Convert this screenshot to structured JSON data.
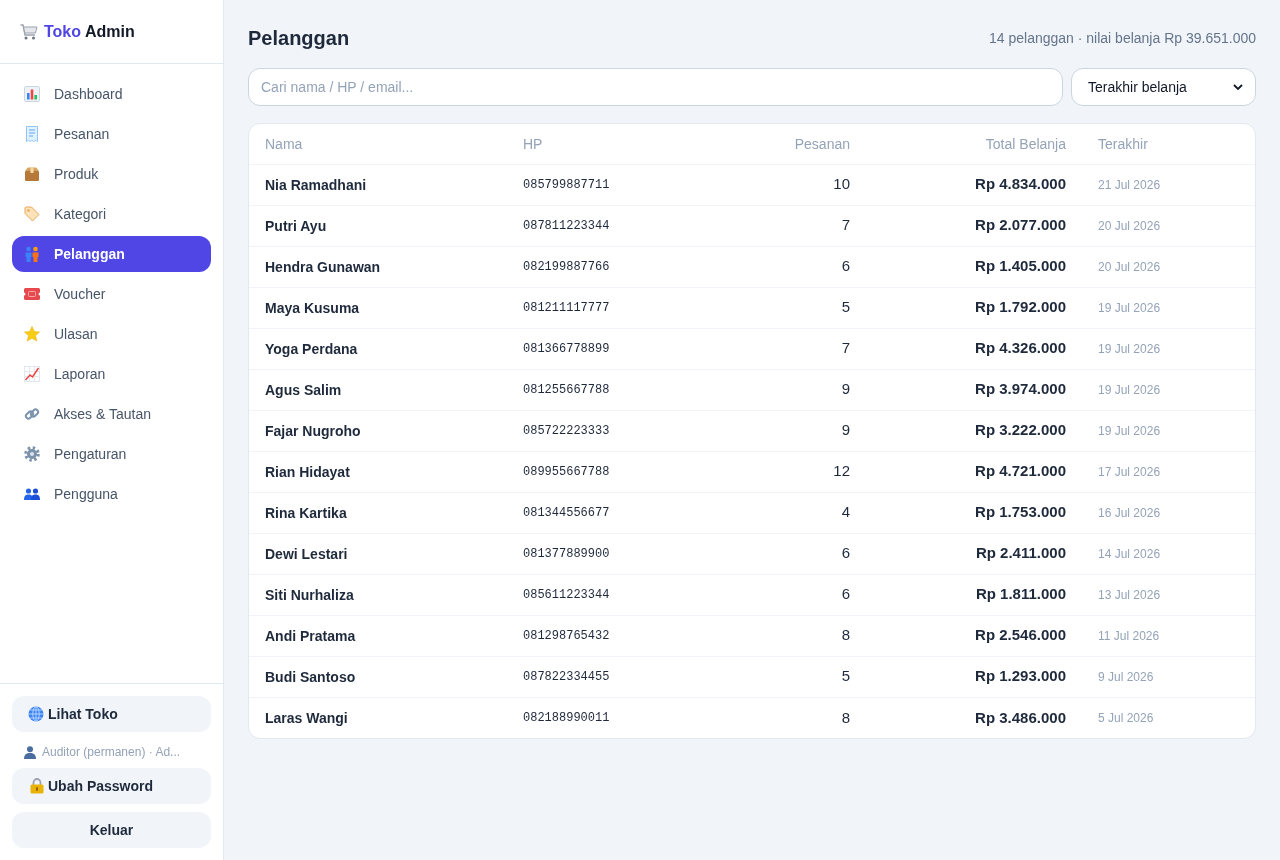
{
  "sidebar": {
    "brand": {
      "accent": "Toko",
      "name": "Admin"
    },
    "items": [
      {
        "label": "Dashboard",
        "selected": false
      },
      {
        "label": "Pesanan",
        "selected": false
      },
      {
        "label": "Produk",
        "selected": false
      },
      {
        "label": "Kategori",
        "selected": false
      },
      {
        "label": "Pelanggan",
        "selected": true
      },
      {
        "label": "Voucher",
        "selected": false
      },
      {
        "label": "Ulasan",
        "selected": false
      },
      {
        "label": "Laporan",
        "selected": false
      },
      {
        "label": "Akses & Tautan",
        "selected": false
      },
      {
        "label": "Pengaturan",
        "selected": false
      },
      {
        "label": "Pengguna",
        "selected": false
      }
    ],
    "footer": {
      "store_button": "Lihat Toko",
      "account": "Auditor (permanen) · Ad...",
      "password_button": "Ubah Password",
      "logout_button": "Keluar"
    }
  },
  "page": {
    "title": "Pelanggan",
    "summary": "14 pelanggan · nilai belanja Rp 39.651.000",
    "search": {
      "placeholder": "Cari nama / HP / email..."
    },
    "sort": {
      "value": "Terakhir belanja"
    }
  },
  "table": {
    "columns": [
      "Nama",
      "HP",
      "Pesanan",
      "Total Belanja",
      "Terakhir"
    ],
    "rows": [
      {
        "nama": "Nia Ramadhani",
        "hp": "085799887711",
        "pesanan": "10",
        "total_belanja": "Rp 4.834.000",
        "terakhir": "21 Jul 2026"
      },
      {
        "nama": "Putri Ayu",
        "hp": "087811223344",
        "pesanan": "7",
        "total_belanja": "Rp 2.077.000",
        "terakhir": "20 Jul 2026"
      },
      {
        "nama": "Hendra Gunawan",
        "hp": "082199887766",
        "pesanan": "6",
        "total_belanja": "Rp 1.405.000",
        "terakhir": "20 Jul 2026"
      },
      {
        "nama": "Maya Kusuma",
        "hp": "081211117777",
        "pesanan": "5",
        "total_belanja": "Rp 1.792.000",
        "terakhir": "19 Jul 2026"
      },
      {
        "nama": "Yoga Perdana",
        "hp": "081366778899",
        "pesanan": "7",
        "total_belanja": "Rp 4.326.000",
        "terakhir": "19 Jul 2026"
      },
      {
        "nama": "Agus Salim",
        "hp": "081255667788",
        "pesanan": "9",
        "total_belanja": "Rp 3.974.000",
        "terakhir": "19 Jul 2026"
      },
      {
        "nama": "Fajar Nugroho",
        "hp": "085722223333",
        "pesanan": "9",
        "total_belanja": "Rp 3.222.000",
        "terakhir": "19 Jul 2026"
      },
      {
        "nama": "Rian Hidayat",
        "hp": "089955667788",
        "pesanan": "12",
        "total_belanja": "Rp 4.721.000",
        "terakhir": "17 Jul 2026"
      },
      {
        "nama": "Rina Kartika",
        "hp": "081344556677",
        "pesanan": "4",
        "total_belanja": "Rp 1.753.000",
        "terakhir": "16 Jul 2026"
      },
      {
        "nama": "Dewi Lestari",
        "hp": "081377889900",
        "pesanan": "6",
        "total_belanja": "Rp 2.411.000",
        "terakhir": "14 Jul 2026"
      },
      {
        "nama": "Siti Nurhaliza",
        "hp": "085611223344",
        "pesanan": "6",
        "total_belanja": "Rp 1.811.000",
        "terakhir": "13 Jul 2026"
      },
      {
        "nama": "Andi Pratama",
        "hp": "081298765432",
        "pesanan": "8",
        "total_belanja": "Rp 2.546.000",
        "terakhir": "11 Jul 2026"
      },
      {
        "nama": "Budi Santoso",
        "hp": "087822334455",
        "pesanan": "5",
        "total_belanja": "Rp 1.293.000",
        "terakhir": "9 Jul 2026"
      },
      {
        "nama": "Laras Wangi",
        "hp": "082188990011",
        "pesanan": "8",
        "total_belanja": "Rp 3.486.000",
        "terakhir": "5 Jul 2026"
      }
    ]
  }
}
